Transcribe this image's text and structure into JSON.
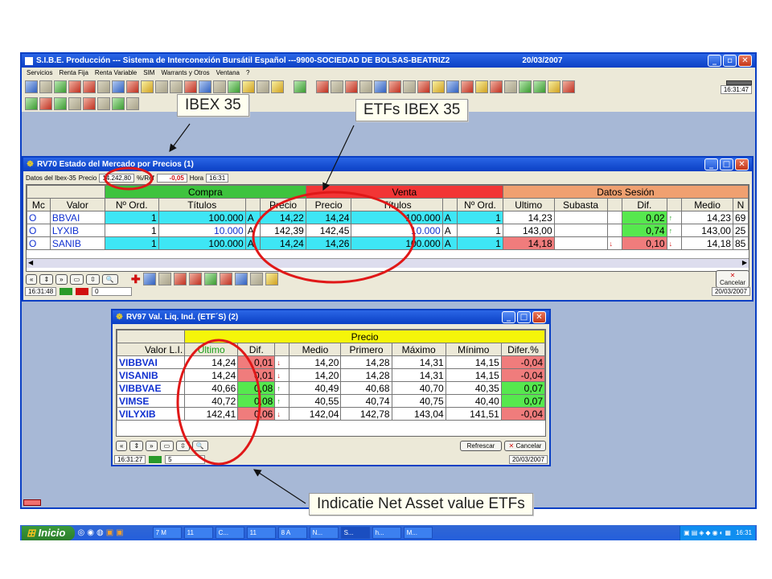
{
  "main_window": {
    "title": "S.I.B.E. Producción --- Sistema de Interconexión Bursátil Español ---9900-SOCIEDAD DE BOLSAS-BEATRIZ2",
    "date": "20/03/2007",
    "menu": [
      "Servicios",
      "Renta Fija",
      "Renta Variable",
      "SIM",
      "Warrants y Otros",
      "Ventana",
      "?"
    ],
    "clock": "16:31:47"
  },
  "callouts": {
    "ibex": "IBEX 35",
    "etfs_ibex": "ETFs IBEX 35",
    "nav": "Indicatie Net Asset value ETFs"
  },
  "rv70": {
    "title": "RV70 Estado del Mercado por Precios (1)",
    "info": {
      "label": "Datos del Ibex-35",
      "precio_label": "Precio",
      "precio": "14.242,80",
      "ref_label": "%/Ref",
      "ref": "-0,05",
      "hora_label": "Hora",
      "hora": "16:31"
    },
    "groups": {
      "compra": "Compra",
      "venta": "Venta",
      "sesion": "Datos Sesión"
    },
    "headers": [
      "Mc",
      "Valor",
      "Nº Ord.",
      "Títulos",
      "",
      "Precio",
      "Precio",
      "Títulos",
      "",
      "Nº Ord.",
      "Ultimo",
      "Subasta",
      "",
      "Dif.",
      "",
      "Medio",
      "N"
    ],
    "rows": [
      {
        "mc": "O",
        "valor": "BBVAI",
        "nord": "1",
        "titulos": "100.000",
        "a": "A",
        "precio_c": "14,22",
        "precio_v": "14,24",
        "titulos_v": "100.000",
        "a2": "A",
        "nord_v": "1",
        "ultimo": "14,23",
        "subasta": "",
        "dir": "",
        "dif": "0,02",
        "arrow": "↑",
        "medio": "14,23",
        "n": "69"
      },
      {
        "mc": "O",
        "valor": "LYXIB",
        "nord": "1",
        "titulos": "10.000",
        "a": "A",
        "precio_c": "142,39",
        "precio_v": "142,45",
        "titulos_v": "10.000",
        "a2": "A",
        "nord_v": "1",
        "ultimo": "143,00",
        "subasta": "",
        "dir": "",
        "dif": "0,74",
        "arrow": "↑",
        "medio": "143,00",
        "n": "25"
      },
      {
        "mc": "O",
        "valor": "SANIB",
        "nord": "1",
        "titulos": "100.000",
        "a": "A",
        "precio_c": "14,24",
        "precio_v": "14,26",
        "titulos_v": "100.000",
        "a2": "A",
        "nord_v": "1",
        "ultimo": "14,18",
        "subasta": "",
        "dir": "↓",
        "dif": "0,10",
        "arrow": "↓",
        "medio": "14,18",
        "n": "85"
      }
    ],
    "status_time": "16:31:48",
    "status_num": "0",
    "cancel": "Cancelar",
    "date": "20/03/2007"
  },
  "rv97": {
    "title": "RV97 Val. Liq. Ind. (ETF´S) (2)",
    "group": "Precio",
    "headers": [
      "Valor L.I.",
      "Ultimo",
      "Dif.",
      "",
      "Medio",
      "Primero",
      "Máximo",
      "Mínimo",
      "Difer.%"
    ],
    "rows": [
      {
        "valor": "VIBBVAI",
        "ultimo": "14,24",
        "dif": "0,01",
        "arrow": "↓",
        "medio": "14,20",
        "primero": "14,28",
        "maximo": "14,31",
        "minimo": "14,15",
        "difer": "-0,04"
      },
      {
        "valor": "VISANIB",
        "ultimo": "14,24",
        "dif": "0,01",
        "arrow": "↓",
        "medio": "14,20",
        "primero": "14,28",
        "maximo": "14,31",
        "minimo": "14,15",
        "difer": "-0,04"
      },
      {
        "valor": "VIBBVAE",
        "ultimo": "40,66",
        "dif": "0,08",
        "arrow": "↑",
        "medio": "40,49",
        "primero": "40,68",
        "maximo": "40,70",
        "minimo": "40,35",
        "difer": "0,07"
      },
      {
        "valor": "VIMSE",
        "ultimo": "40,72",
        "dif": "0,08",
        "arrow": "↑",
        "medio": "40,55",
        "primero": "40,74",
        "maximo": "40,75",
        "minimo": "40,40",
        "difer": "0,07"
      },
      {
        "valor": "VILYXIB",
        "ultimo": "142,41",
        "dif": "0,06",
        "arrow": "↓",
        "medio": "142,04",
        "primero": "142,78",
        "maximo": "143,04",
        "minimo": "141,51",
        "difer": "-0,04"
      }
    ],
    "refrescar": "Refrescar",
    "cancel": "Cancelar",
    "status_time": "16:31:27",
    "status_num": "5",
    "date": "20/03/2007"
  },
  "taskbar": {
    "start": "Inicio",
    "tasks": [
      "7 M",
      "11",
      "C...",
      "11",
      "8 A",
      "N...",
      "S...",
      "h...",
      "M..."
    ],
    "time": "16:31"
  }
}
